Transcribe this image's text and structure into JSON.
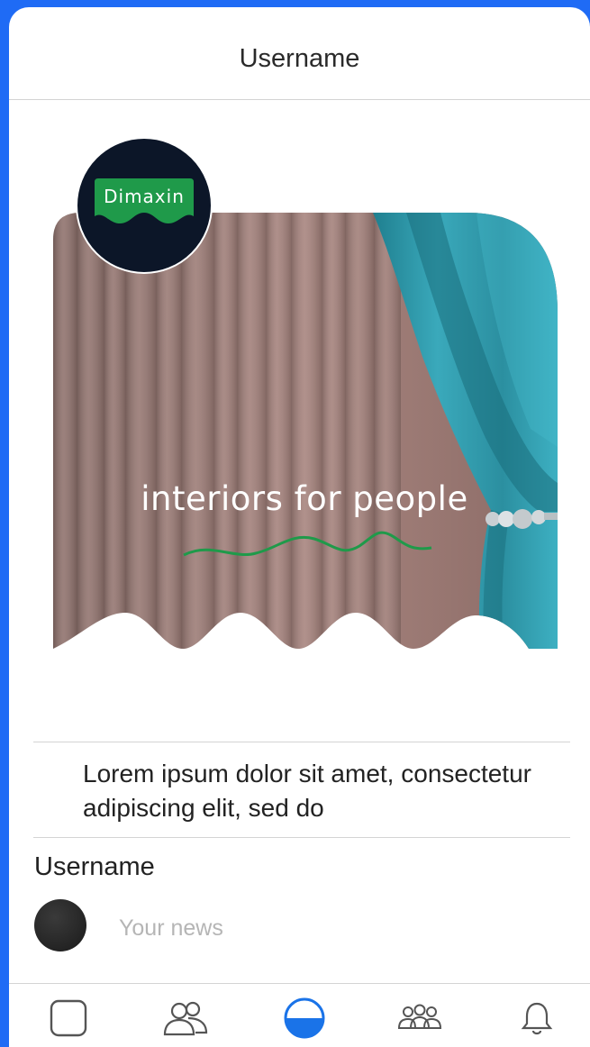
{
  "header": {
    "title": "Username"
  },
  "post": {
    "brand_name": "Dimaxin",
    "tagline": "interiors for people",
    "text": "Lorem ipsum dolor sit amet, consectetur adipiscing elit, sed do"
  },
  "composer": {
    "username": "Username",
    "placeholder": "Your news"
  },
  "nav": {
    "items": [
      {
        "icon": "square-icon"
      },
      {
        "icon": "friends-icon"
      },
      {
        "icon": "home-circle-icon",
        "active": true
      },
      {
        "icon": "groups-icon"
      },
      {
        "icon": "bell-icon"
      }
    ],
    "accent": "#1a73e8"
  },
  "colors": {
    "frame": "#1f6bf5",
    "brand_green": "#1f9a4a",
    "brand_dark": "#0c1628"
  }
}
